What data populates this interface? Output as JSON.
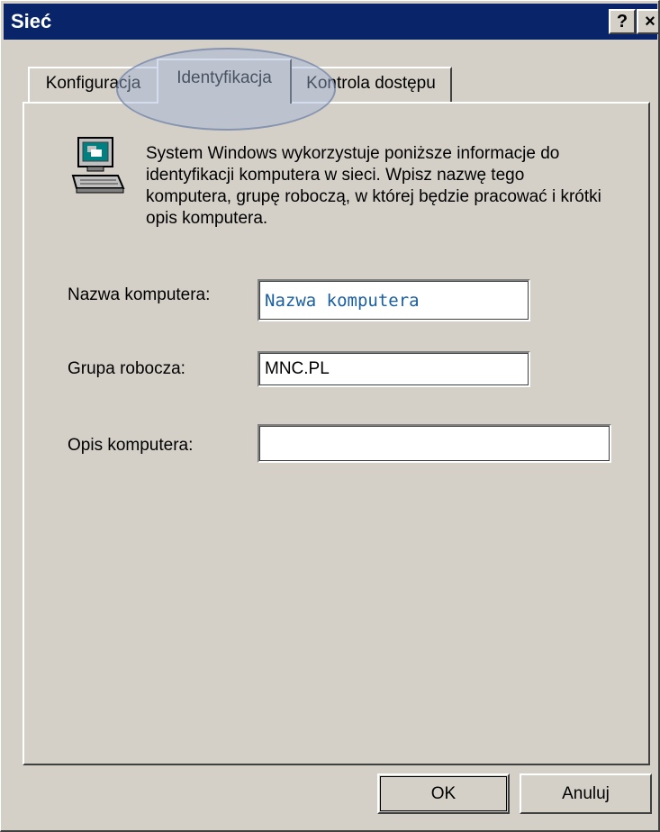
{
  "window": {
    "title": "Sieć",
    "help_label": "?",
    "close_label": "×"
  },
  "tabs": [
    {
      "label": "Konfiguracja",
      "selected": false
    },
    {
      "label": "Identyfikacja",
      "selected": true
    },
    {
      "label": "Kontrola dostępu",
      "selected": false
    }
  ],
  "info": {
    "icon": "computer-icon",
    "text": "System Windows wykorzystuje poniższe informacje do identyfikacji komputera w sieci. Wpisz nazwę tego komputera, grupę roboczą, w której będzie pracować i krótki opis komputera."
  },
  "form": {
    "computer_name_label": "Nazwa komputera:",
    "computer_name_value": "Nazwa komputera",
    "workgroup_label": "Grupa robocza:",
    "workgroup_value": "MNC.PL",
    "description_label": "Opis komputera:",
    "description_value": ""
  },
  "buttons": {
    "ok_label": "OK",
    "cancel_label": "Anuluj"
  },
  "colors": {
    "titlebar": "#0a246a",
    "face": "#d4d0c8",
    "field_text_highlight": "#1a5fa0"
  }
}
